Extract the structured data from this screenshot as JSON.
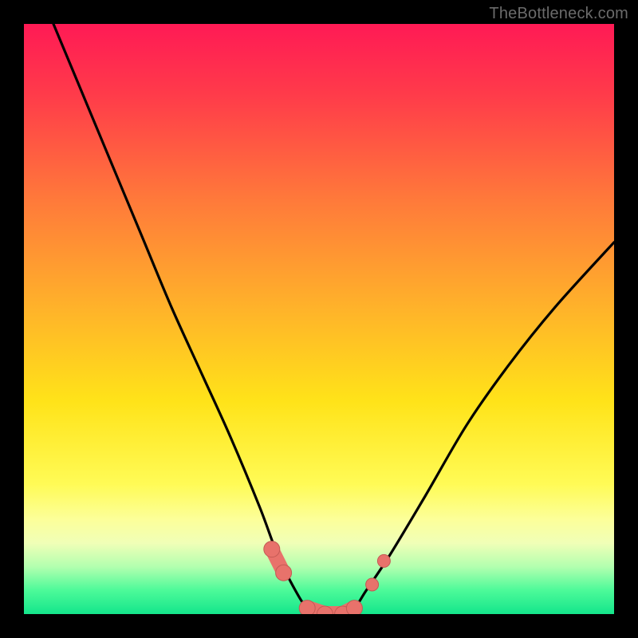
{
  "watermark": "TheBottleneck.com",
  "chart_data": {
    "type": "line",
    "title": "",
    "xlabel": "",
    "ylabel": "",
    "xlim": [
      0,
      100
    ],
    "ylim": [
      0,
      100
    ],
    "series": [
      {
        "name": "bottleneck-curve",
        "x": [
          5,
          10,
          15,
          20,
          25,
          30,
          35,
          40,
          43,
          46,
          48,
          50,
          52,
          54,
          56,
          58,
          62,
          68,
          75,
          82,
          90,
          100
        ],
        "values": [
          100,
          88,
          76,
          64,
          52,
          41,
          30,
          18,
          10,
          4,
          1,
          0,
          0,
          0,
          1,
          4,
          10,
          20,
          32,
          42,
          52,
          63
        ]
      }
    ],
    "markers": [
      {
        "name": "bead-left-cluster-start",
        "x": 42,
        "y": 11
      },
      {
        "name": "bead-left-cluster-end",
        "x": 44,
        "y": 7
      },
      {
        "name": "bead-floor-1",
        "x": 48,
        "y": 1
      },
      {
        "name": "bead-floor-2",
        "x": 51,
        "y": 0
      },
      {
        "name": "bead-floor-3",
        "x": 54,
        "y": 0
      },
      {
        "name": "bead-floor-4",
        "x": 56,
        "y": 1
      },
      {
        "name": "bead-right-1",
        "x": 59,
        "y": 5
      },
      {
        "name": "bead-right-2",
        "x": 61,
        "y": 9
      }
    ],
    "colors": {
      "curve_stroke": "#000000",
      "bead_fill": "#e8726b",
      "bead_stroke": "#c45a54"
    }
  }
}
